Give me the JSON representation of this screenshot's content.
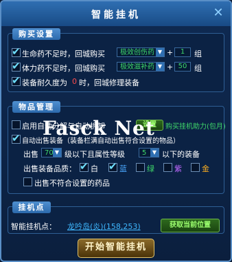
{
  "window": {
    "title": "智能挂机",
    "close_icon": "close-x-icon"
  },
  "purchase": {
    "header": "购买设置",
    "hp_row": {
      "checked": true,
      "label": "生命药不足时，回城购买",
      "item": "极效创伤药",
      "qty": "1",
      "unit": "组"
    },
    "mp_row": {
      "checked": true,
      "label": "体力药不足时，回城购买",
      "item": "极效滋补药",
      "qty": "50",
      "unit": "组"
    },
    "repair_row": {
      "checked": true,
      "label_before": "装备耐久度为",
      "value": "0",
      "label_after": "时，回城修理装备"
    }
  },
  "items": {
    "header": "物品管理",
    "auto_decompose": {
      "checked": false,
      "label": "启用自动分解与自动拆卸",
      "settings_button": "设置",
      "buy_button": "购买挂机助力(包月)"
    },
    "auto_sell": {
      "checked": true,
      "label": "自动出售装备（装备栏满自动出售符合设置的物品）"
    },
    "sell_level": {
      "label_prefix": "出售",
      "level": "70",
      "label_mid": "级以下且属性等级",
      "attr_level": "5",
      "label_suffix": "以下的装备"
    },
    "quality": {
      "label": "出售装备品质：",
      "options": [
        {
          "checked": true,
          "label": "白",
          "color": "#ffffff"
        },
        {
          "checked": true,
          "label": "蓝",
          "color": "#4aa8ff"
        },
        {
          "checked": false,
          "label": "绿",
          "color": "#3fd86a"
        },
        {
          "checked": false,
          "label": "紫",
          "color": "#c068ff"
        },
        {
          "checked": false,
          "label": "金",
          "color": "#ffb020"
        }
      ]
    },
    "sell_potions": {
      "checked": false,
      "label": "出售不符合设置的药品"
    }
  },
  "hangpoint": {
    "header": "挂机点",
    "label": "智能挂机点：",
    "value": "龙吟岛(炎)(158,253)",
    "get_button": "获取当前位置"
  },
  "start_button": "开始智能挂机",
  "watermark": "Fasck Net"
}
